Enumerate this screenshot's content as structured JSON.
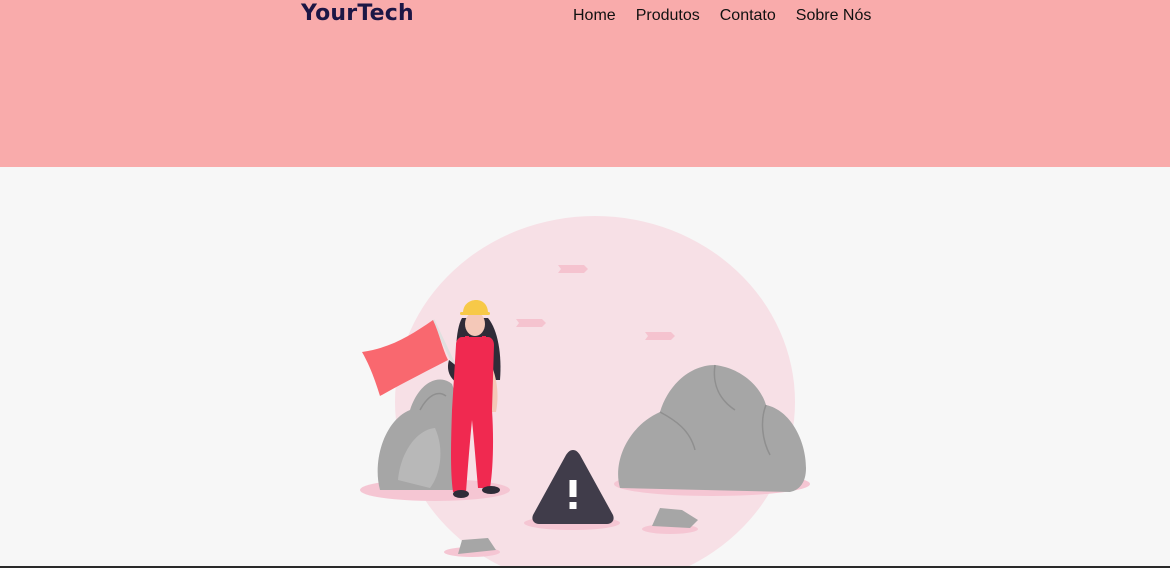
{
  "header": {
    "logo": "YourTech",
    "nav": [
      {
        "label": "Home"
      },
      {
        "label": "Produtos"
      },
      {
        "label": "Contato"
      },
      {
        "label": "Sobre Nós"
      }
    ]
  },
  "colors": {
    "header_bg": "#f9abab",
    "page_bg": "#f7f7f7",
    "logo": "#1c1645",
    "circle": "#f7e0e6",
    "rock": "#a6a6a6",
    "overalls": "#f02950",
    "flag": "#f9686f",
    "helmet": "#f7c948",
    "warning_sign": "#403c4a"
  },
  "main": {
    "illustration": {
      "icon": "under-construction-illustration"
    }
  }
}
